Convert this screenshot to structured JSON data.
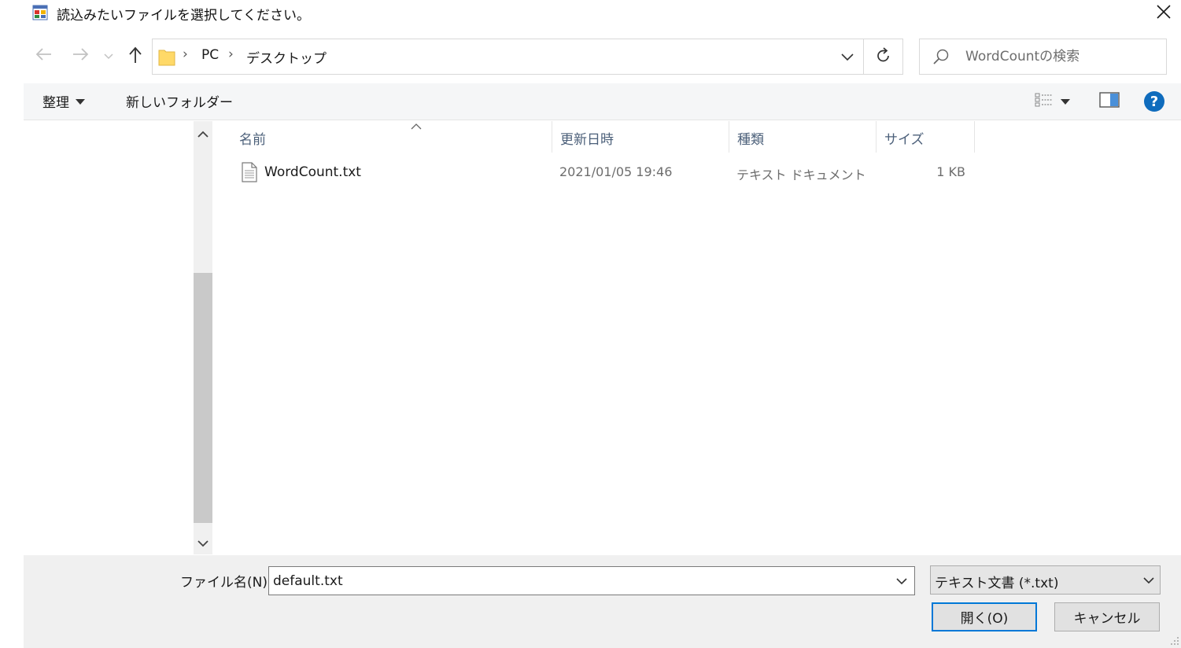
{
  "window": {
    "title": "読込みたいファイルを選択してください。",
    "app_icon": "form-app-icon",
    "close_icon": "close-icon"
  },
  "navigation": {
    "back_icon": "arrow-left-icon",
    "forward_icon": "arrow-right-icon",
    "recent_icon": "chevron-down-icon",
    "up_icon": "arrow-up-icon"
  },
  "address": {
    "folder_icon": "folder-icon",
    "breadcrumbs": [
      "PC",
      "デスクトップ"
    ],
    "separator": "›",
    "dropdown_icon": "chevron-down-icon",
    "refresh_icon": "refresh-icon"
  },
  "search": {
    "placeholder": "WordCountの検索",
    "icon": "search-icon"
  },
  "toolbar": {
    "organize_label": "整理",
    "new_folder_label": "新しいフォルダー",
    "view_icon": "details-view-icon",
    "preview_pane_icon": "preview-pane-icon",
    "help_icon": "help-icon",
    "help_glyph": "?"
  },
  "file_list": {
    "columns": [
      "名前",
      "更新日時",
      "種類",
      "サイズ"
    ],
    "rows": [
      {
        "icon": "text-file-icon",
        "name": "WordCount.txt",
        "modified": "2021/01/05 19:46",
        "type": "テキスト ドキュメント",
        "size": "1 KB"
      }
    ]
  },
  "footer": {
    "filename_label": "ファイル名(N):",
    "filename_value": "default.txt",
    "filter_value": "テキスト文書 (*.txt)",
    "open_label": "開く(O)",
    "cancel_label": "キャンセル"
  },
  "colors": {
    "accent": "#0078d7",
    "help_blue": "#0f6cbd",
    "folder_yellow": "#ffd968",
    "column_header_text": "#4c607a",
    "toolbar_bg": "#f5f6f7",
    "footer_bg": "#f0f0f0"
  }
}
